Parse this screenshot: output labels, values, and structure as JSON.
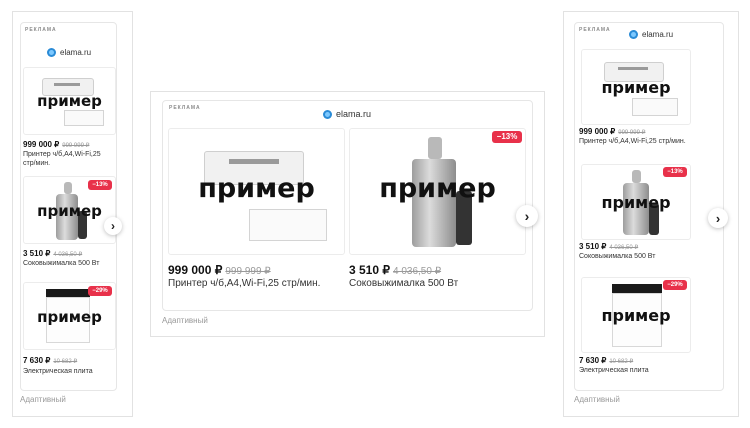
{
  "ad_label": "РЕКЛАМА",
  "brand": "elama.ru",
  "sample_text": "пример",
  "adaptive_label": "Адаптивный",
  "next_arrow": "›",
  "products": [
    {
      "price": "999 000 ₽",
      "old_price": "999 999 ₽",
      "name": "Принтер ч/б,А4,Wi-Fi,25 стр/мин.",
      "discount": "",
      "kind": "printer"
    },
    {
      "price": "3 510 ₽",
      "old_price": "4 036,50 ₽",
      "name": "Соковыжималка 500 Вт",
      "discount": "−13%",
      "kind": "juicer"
    },
    {
      "price": "7 630 ₽",
      "old_price": "10 682 ₽",
      "name": "Электрическая плита",
      "discount": "−29%",
      "kind": "stove"
    }
  ],
  "colors": {
    "discount": "#e8314a",
    "brand_logo": "#2a8bd6"
  },
  "icons": {
    "brand_logo": "elama-logo-icon",
    "next": "chevron-right-icon"
  }
}
